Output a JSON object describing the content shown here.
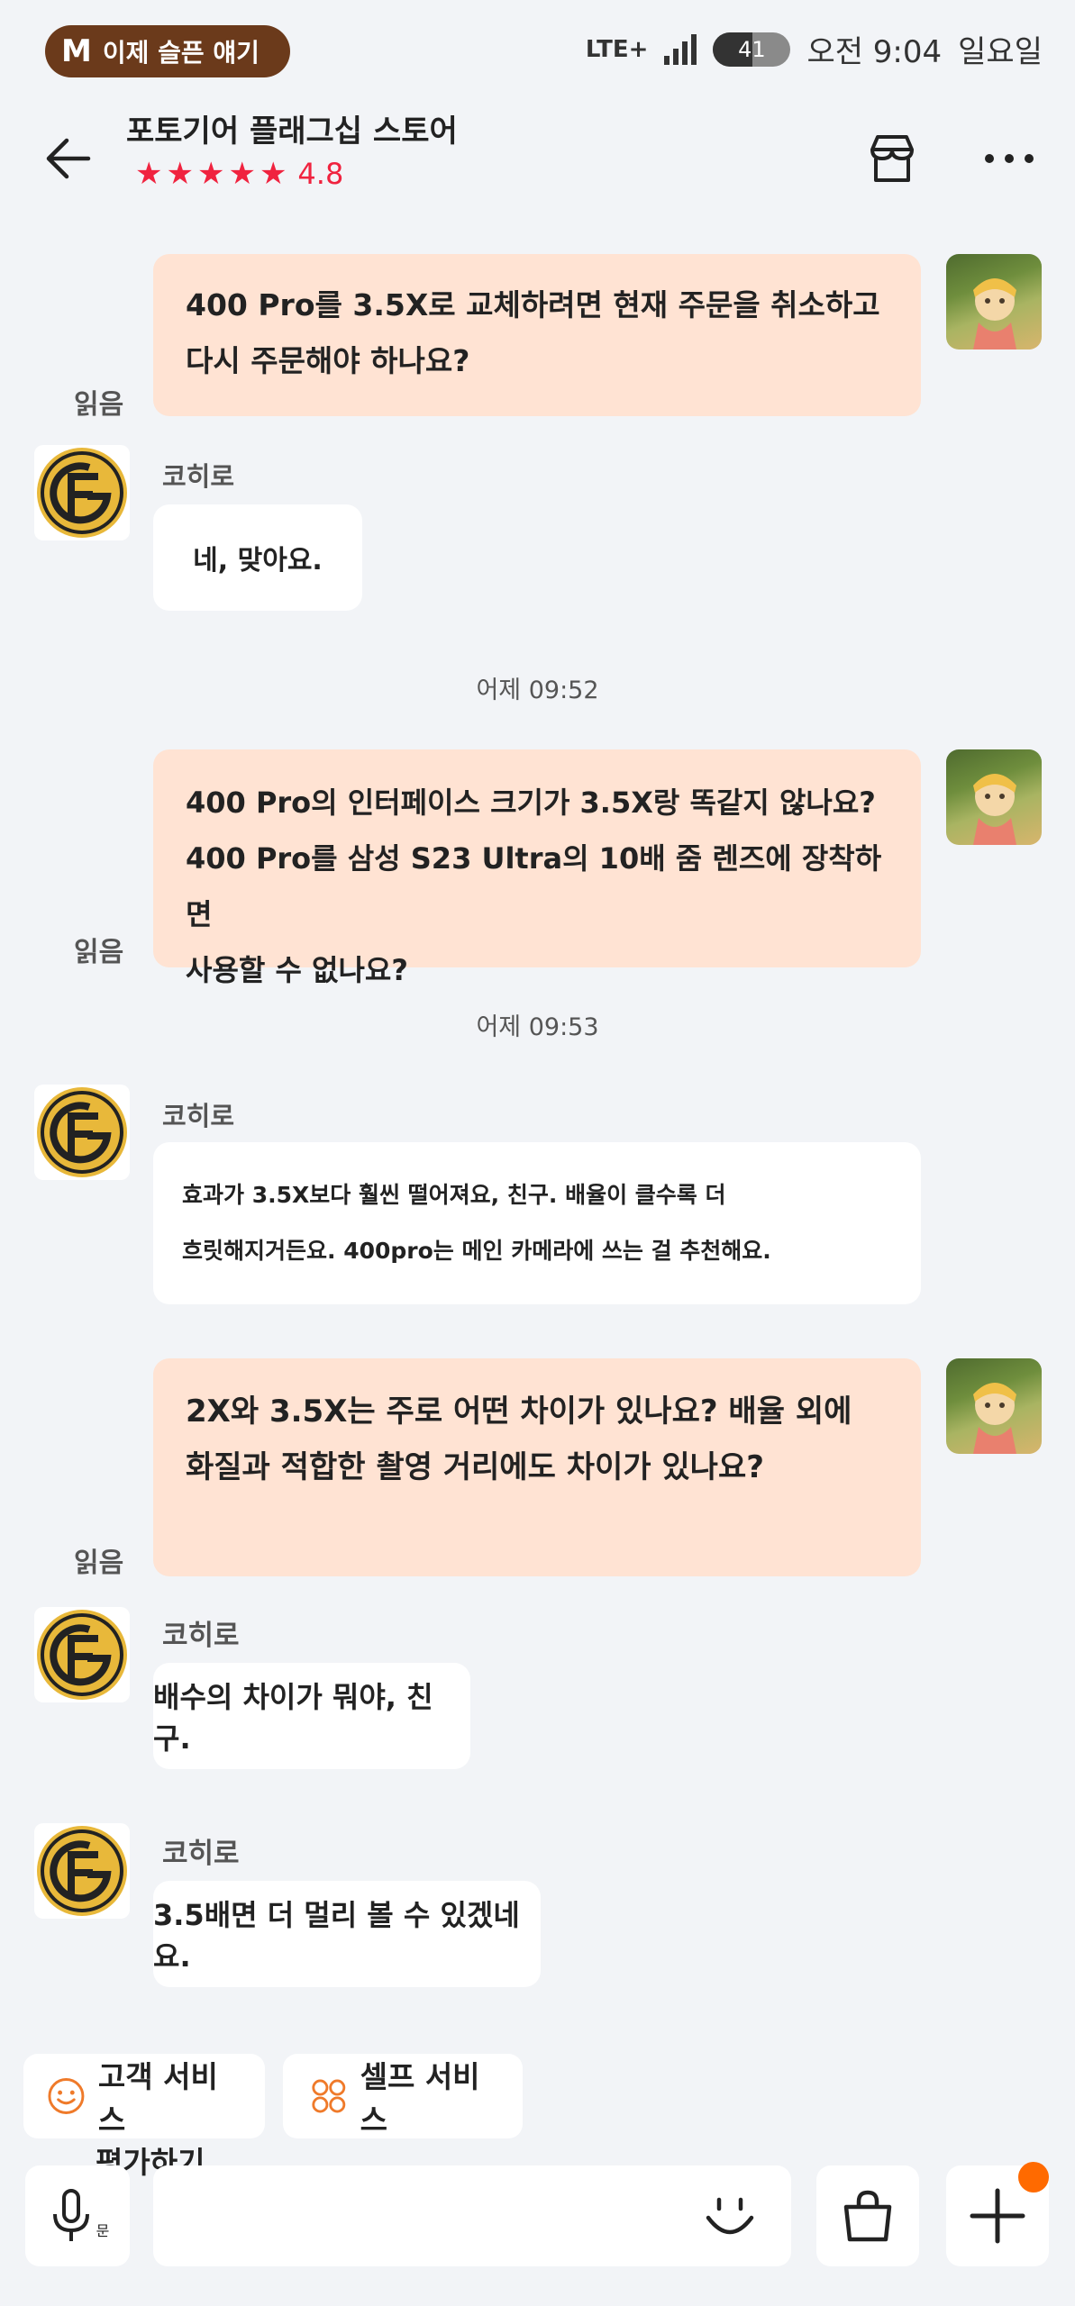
{
  "status_bar": {
    "app_notice": "이제 슬픈 얘기",
    "app_notice_icon": "M",
    "network": "LTE+",
    "battery": "41",
    "time": "오전 9:04",
    "day": "일요일"
  },
  "header": {
    "store_name": "포토기어 플래그십 스토어",
    "rating_stars": 5,
    "rating_value": "4.8",
    "back_icon": "arrow-left-icon",
    "store_icon": "store-icon",
    "more_icon": "more-dots-icon"
  },
  "messages": [
    {
      "type": "outgoing",
      "lines": [
        "400 Pro를 3.5X로 교체하려면 현재 주문을 취소하고",
        "다시 주문해야 하나요?"
      ],
      "status": "읽음"
    },
    {
      "type": "incoming",
      "sender": "코히로",
      "text": "네, 맞아요."
    },
    {
      "type": "timestamp",
      "text": "어제 09:52"
    },
    {
      "type": "outgoing",
      "lines": [
        "400 Pro의 인터페이스 크기가 3.5X랑 똑같지 않나요?",
        "400 Pro를 삼성 S23 Ultra의 10배 줌 렌즈에 장착하면",
        "사용할 수 없나요?"
      ],
      "status": "읽음"
    },
    {
      "type": "timestamp",
      "text": "어제 09:53"
    },
    {
      "type": "incoming",
      "sender": "코히로",
      "lines": [
        "효과가 3.5X보다 훨씬 떨어져요, 친구. 배율이 클수록 더",
        "흐릿해지거든요. 400pro는 메인 카메라에 쓰는 걸 추천해요."
      ]
    },
    {
      "type": "outgoing",
      "lines": [
        "2X와 3.5X는 주로 어떤 차이가 있나요? 배율 외에",
        "화질과 적합한 촬영 거리에도 차이가 있나요?"
      ],
      "status": "읽음"
    },
    {
      "type": "incoming",
      "sender": "코히로",
      "text": "배수의 차이가 뭐야, 친구."
    },
    {
      "type": "incoming",
      "sender": "코히로",
      "text": "3.5배면 더 멀리 볼 수 있겠네요."
    }
  ],
  "quick_actions": [
    {
      "label": "고객 서비스",
      "icon": "smile-icon"
    },
    {
      "label": "셀프 서비스",
      "icon": "grid-circles-icon"
    }
  ],
  "rate_label": "평가하기",
  "input_bar": {
    "voice_icon": "microphone-icon",
    "voice_sub": "문",
    "emoji_icon": "emoji-smile-icon",
    "bag_icon": "shopping-bag-icon",
    "plus_icon": "plus-icon"
  },
  "colors": {
    "outgoing_bubble": "#ffe3d3",
    "incoming_bubble": "#ffffff",
    "background": "#f2f4f7",
    "rating": "#f0233f",
    "badge": "#ff6a00",
    "shop_logo": "#e8b83a"
  }
}
